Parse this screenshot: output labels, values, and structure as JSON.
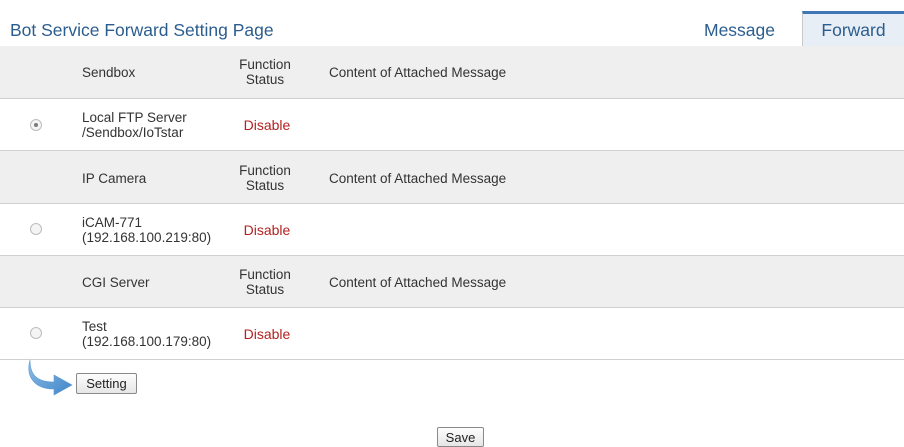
{
  "page": {
    "title": "Bot Service Forward Setting Page"
  },
  "tabs": {
    "message": "Message",
    "forward": "Forward"
  },
  "columns": {
    "function_status": [
      "Function",
      "Status"
    ],
    "content": "Content of Attached Message"
  },
  "sections": [
    {
      "name": "Sendbox",
      "items": [
        {
          "name_lines": [
            "Local FTP Server",
            "/Sendbox/IoTstar"
          ],
          "status": "Disable",
          "selected": true
        }
      ]
    },
    {
      "name": "IP Camera",
      "items": [
        {
          "name_lines": [
            "iCAM-771",
            "(192.168.100.219:80)"
          ],
          "status": "Disable",
          "selected": false
        }
      ]
    },
    {
      "name": "CGI Server",
      "items": [
        {
          "name_lines": [
            "Test",
            "(192.168.100.179:80)"
          ],
          "status": "Disable",
          "selected": false
        }
      ]
    }
  ],
  "buttons": {
    "setting": "Setting",
    "save": "Save"
  },
  "colors": {
    "title": "#2b5d8e",
    "status_disabled": "#b22222",
    "header_row": "#efefef",
    "tab_active": "#e7eef6",
    "arrow": "#5b9bd5"
  }
}
